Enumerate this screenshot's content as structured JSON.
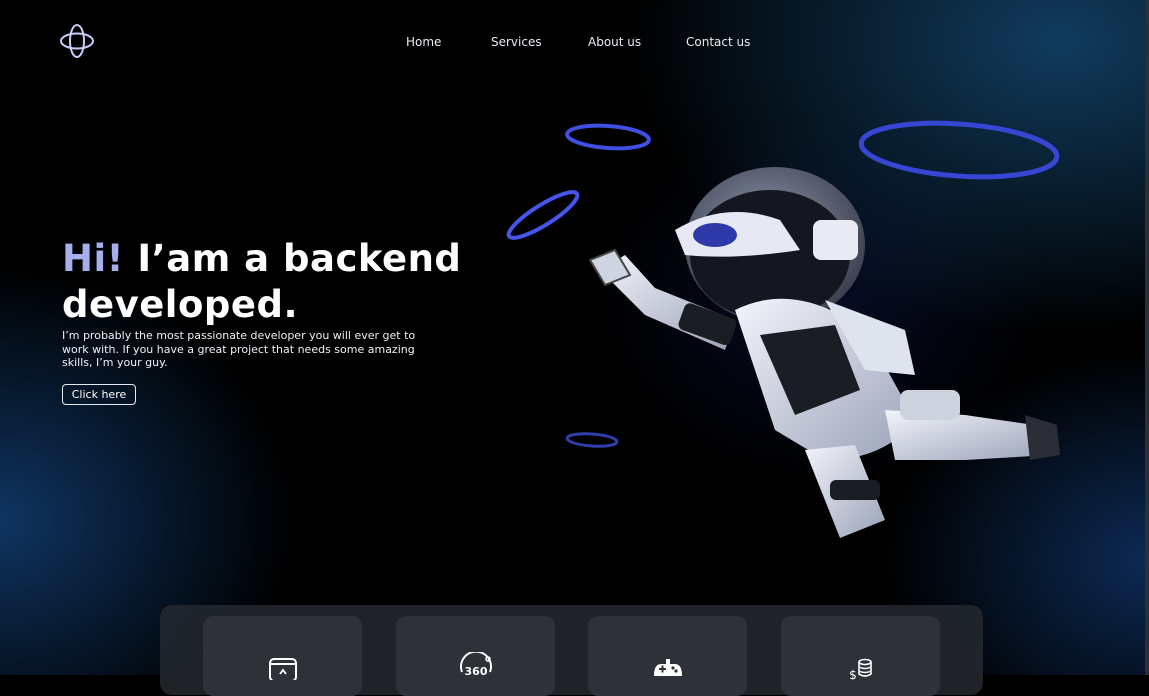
{
  "header": {
    "logo_icon": "orbit-logo-icon",
    "nav": [
      {
        "label": "Home"
      },
      {
        "label": "Services"
      },
      {
        "label": "About us"
      },
      {
        "label": "Contact us"
      }
    ]
  },
  "hero": {
    "greeting": "Hi!",
    "title_rest": " I’am a backend developed.",
    "description": "I’m probably the most passionate developer you will ever get to work with. If you have a great project that needs some amazing skills, I’m your guy.",
    "cta_label": "Click here",
    "illustration": "astronaut-robot-image"
  },
  "services": {
    "cards": [
      {
        "icon": "app-box-icon"
      },
      {
        "icon": "360-view-icon"
      },
      {
        "icon": "gamepad-icon"
      },
      {
        "icon": "coins-icon"
      }
    ]
  },
  "colors": {
    "accent": "#a3b0ec",
    "ring": "#3f4fe0",
    "background": "#000000",
    "card": "#2e3238"
  }
}
